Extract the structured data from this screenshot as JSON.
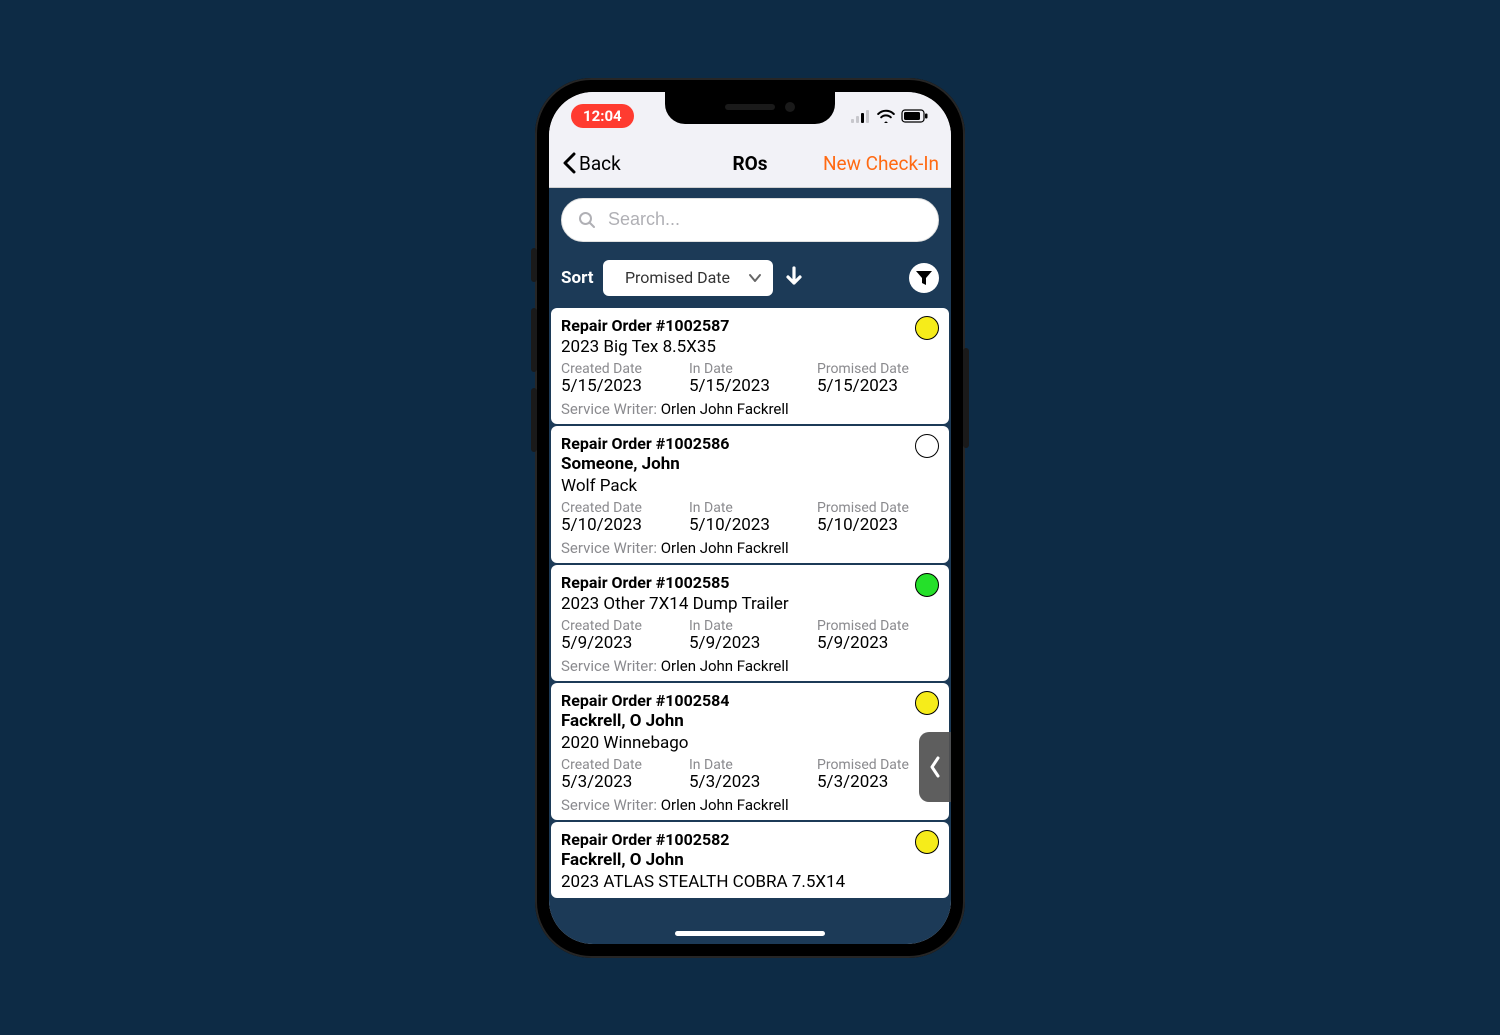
{
  "status": {
    "time": "12:04"
  },
  "nav": {
    "back": "Back",
    "title": "ROs",
    "action": "New Check-In"
  },
  "search": {
    "placeholder": "Search..."
  },
  "sort": {
    "label": "Sort",
    "selected": "Promised Date"
  },
  "labels": {
    "created": "Created Date",
    "in": "In Date",
    "promised": "Promised Date",
    "sw": "Service Writer:"
  },
  "ros": [
    {
      "title": "Repair Order #1002587",
      "customer": "",
      "unit": "2023 Big Tex 8.5X35",
      "created": "5/15/2023",
      "in": "5/15/2023",
      "promised": "5/15/2023",
      "writer": "Orlen John Fackrell",
      "status_color": "#f6ec1a"
    },
    {
      "title": "Repair Order #1002586",
      "customer": "Someone, John",
      "unit": "Wolf Pack",
      "created": "5/10/2023",
      "in": "5/10/2023",
      "promised": "5/10/2023",
      "writer": "Orlen John Fackrell",
      "status_color": "#ffffff"
    },
    {
      "title": "Repair Order #1002585",
      "customer": "",
      "unit": "2023 Other 7X14 Dump Trailer",
      "created": "5/9/2023",
      "in": "5/9/2023",
      "promised": "5/9/2023",
      "writer": "Orlen John Fackrell",
      "status_color": "#25e02a"
    },
    {
      "title": "Repair Order #1002584",
      "customer": "Fackrell, O John",
      "unit": "2020 Winnebago",
      "created": "5/3/2023",
      "in": "5/3/2023",
      "promised": "5/3/2023",
      "writer": "Orlen John Fackrell",
      "status_color": "#f6ec1a"
    },
    {
      "title": "Repair Order #1002582",
      "customer": "Fackrell, O John",
      "unit": "2023 ATLAS STEALTH COBRA 7.5X14",
      "created": "",
      "in": "",
      "promised": "",
      "writer": "",
      "status_color": "#f6ec1a"
    }
  ]
}
